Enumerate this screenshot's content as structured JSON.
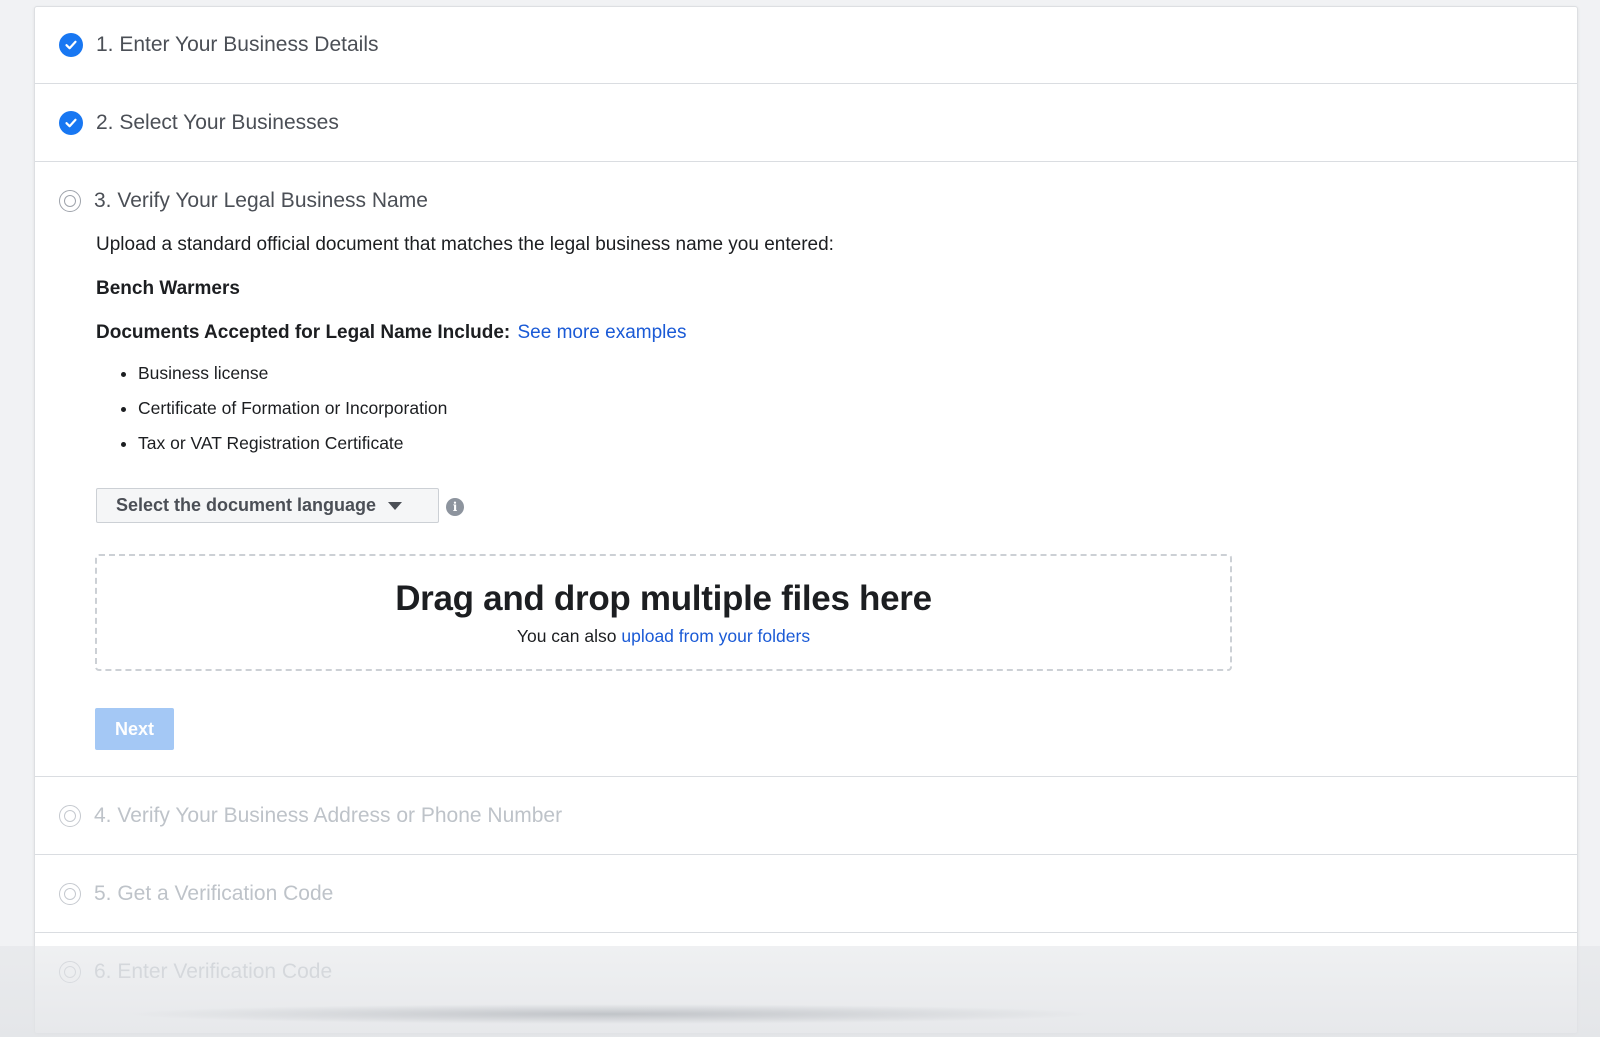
{
  "steps": [
    {
      "label": "1. Enter Your Business Details",
      "status": "complete"
    },
    {
      "label": "2. Select Your Businesses",
      "status": "complete"
    },
    {
      "label": "3. Verify Your Legal Business Name",
      "status": "active"
    },
    {
      "label": "4. Verify Your Business Address or Phone Number",
      "status": "pending"
    },
    {
      "label": "5. Get a Verification Code",
      "status": "pending"
    },
    {
      "label": "6. Enter Verification Code",
      "status": "pending"
    }
  ],
  "verify": {
    "intro": "Upload a standard official document that matches the legal business name you entered:",
    "business_name": "Bench Warmers",
    "docs_heading": "Documents Accepted for Legal Name Include:",
    "see_more_link": "See more examples",
    "docs": [
      "Business license",
      "Certificate of Formation or Incorporation",
      "Tax or VAT Registration Certificate"
    ],
    "language_select": "Select the document language",
    "dropzone_title": "Drag and drop multiple files here",
    "dropzone_sub": "You can also",
    "dropzone_link": "upload from your folders",
    "next_button": "Next"
  },
  "colors": {
    "accent": "#1877f2",
    "link": "#1a5ad6",
    "disabled_button": "#a4c8f5"
  }
}
